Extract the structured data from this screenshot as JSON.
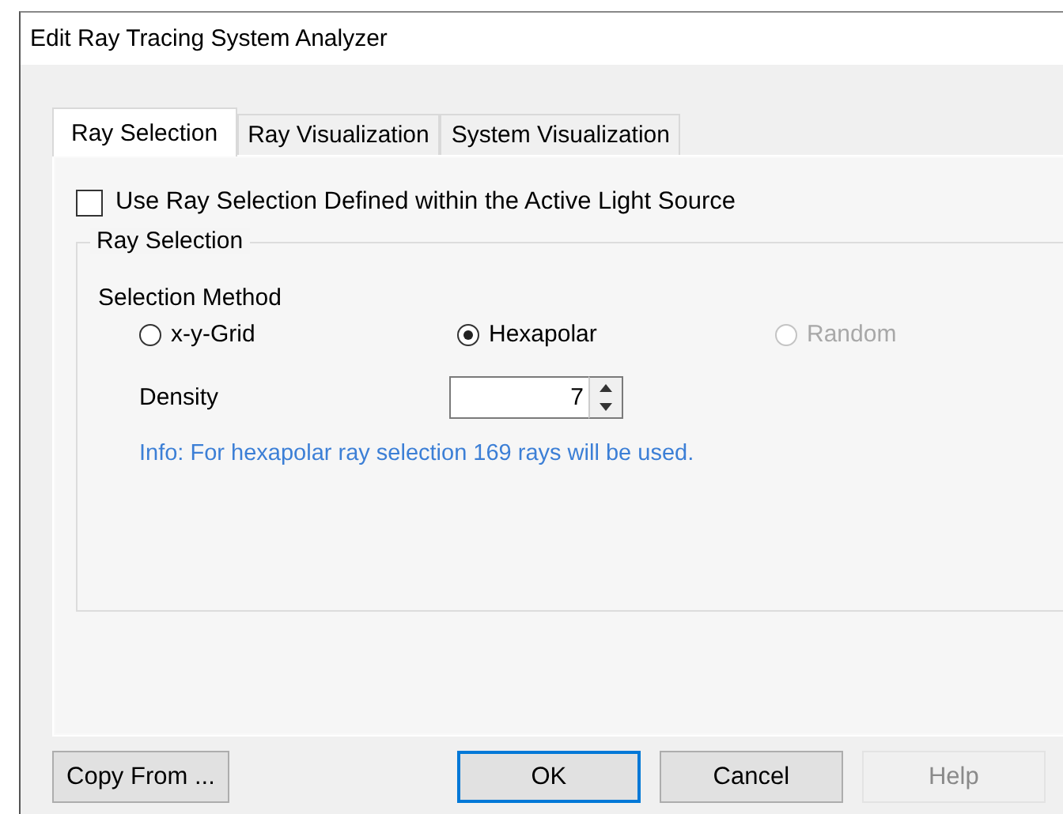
{
  "window": {
    "title": "Edit Ray Tracing System Analyzer"
  },
  "tabs": [
    {
      "label": "Ray Selection",
      "selected": true
    },
    {
      "label": "Ray Visualization",
      "selected": false
    },
    {
      "label": "System Visualization",
      "selected": false
    }
  ],
  "use_source_checkbox": {
    "label": "Use Ray Selection Defined within the Active Light Source",
    "checked": false
  },
  "group": {
    "title": "Ray Selection",
    "method_label": "Selection Method",
    "methods": [
      {
        "label": "x-y-Grid",
        "selected": false,
        "disabled": false
      },
      {
        "label": "Hexapolar",
        "selected": true,
        "disabled": false
      },
      {
        "label": "Random",
        "selected": false,
        "disabled": true
      }
    ],
    "density": {
      "label": "Density",
      "value": "7"
    },
    "info": "Info: For hexapolar ray selection 169 rays will be used."
  },
  "buttons": [
    {
      "label": "Copy From ...",
      "kind": "left",
      "default": false,
      "disabled": false
    },
    {
      "label": "OK",
      "kind": "right",
      "default": true,
      "disabled": false
    },
    {
      "label": "Cancel",
      "kind": "right",
      "default": false,
      "disabled": false
    },
    {
      "label": "Help",
      "kind": "right",
      "default": false,
      "disabled": true
    }
  ]
}
